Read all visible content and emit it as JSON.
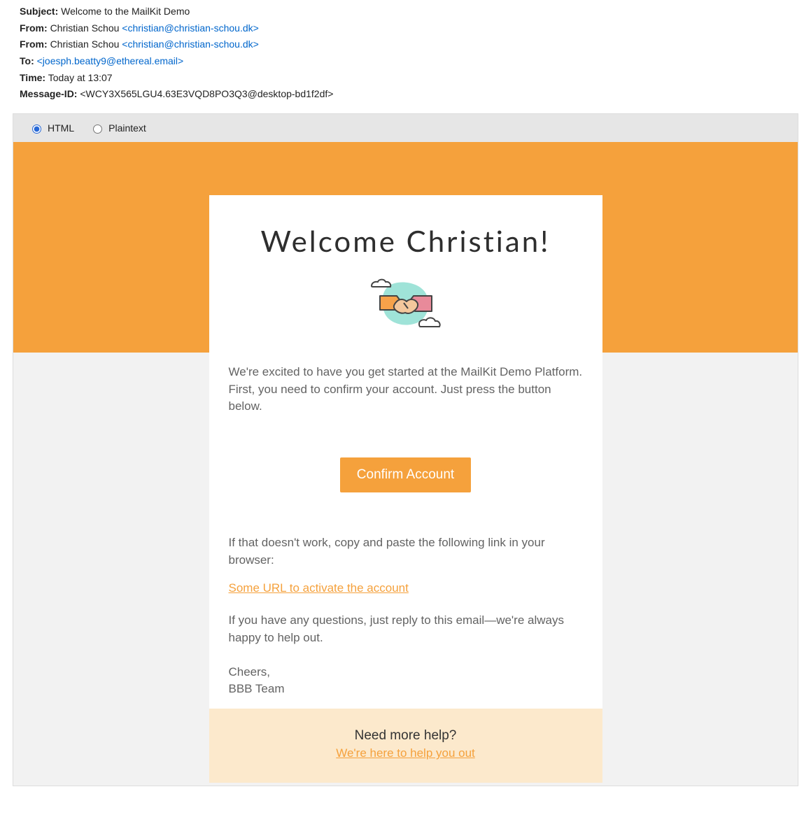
{
  "meta": {
    "subject_label": "Subject:",
    "subject_value": "Welcome to the MailKit Demo",
    "from_label": "From:",
    "from1_name": "Christian Schou ",
    "from1_email": "<christian@christian-schou.dk>",
    "from2_name": "Christian Schou ",
    "from2_email": "<christian@christian-schou.dk>",
    "to_label": "To:",
    "to_email": "<joesph.beatty9@ethereal.email>",
    "time_label": "Time:",
    "time_value": "Today at 13:07",
    "msgid_label": "Message-ID:",
    "msgid_value": "<WCY3X565LGU4.63E3VQD8PO3Q3@desktop-bd1f2df>"
  },
  "view": {
    "html_label": "HTML",
    "plaintext_label": "Plaintext"
  },
  "email": {
    "title": "Welcome Christian!",
    "intro": "We're excited to have you get started at the MailKit Demo Platform. First, you need to confirm your account. Just press the button below.",
    "confirm_button": "Confirm Account",
    "fallback": "If that doesn't work, copy and paste the following link in your browser:",
    "activation_link": "Some URL to activate the account",
    "questions": "If you have any questions, just reply to this email—we're always happy to help out.",
    "signoff1": "Cheers,",
    "signoff2": "BBB Team",
    "help_title": "Need more help?",
    "help_link": "We're here to help you out"
  }
}
